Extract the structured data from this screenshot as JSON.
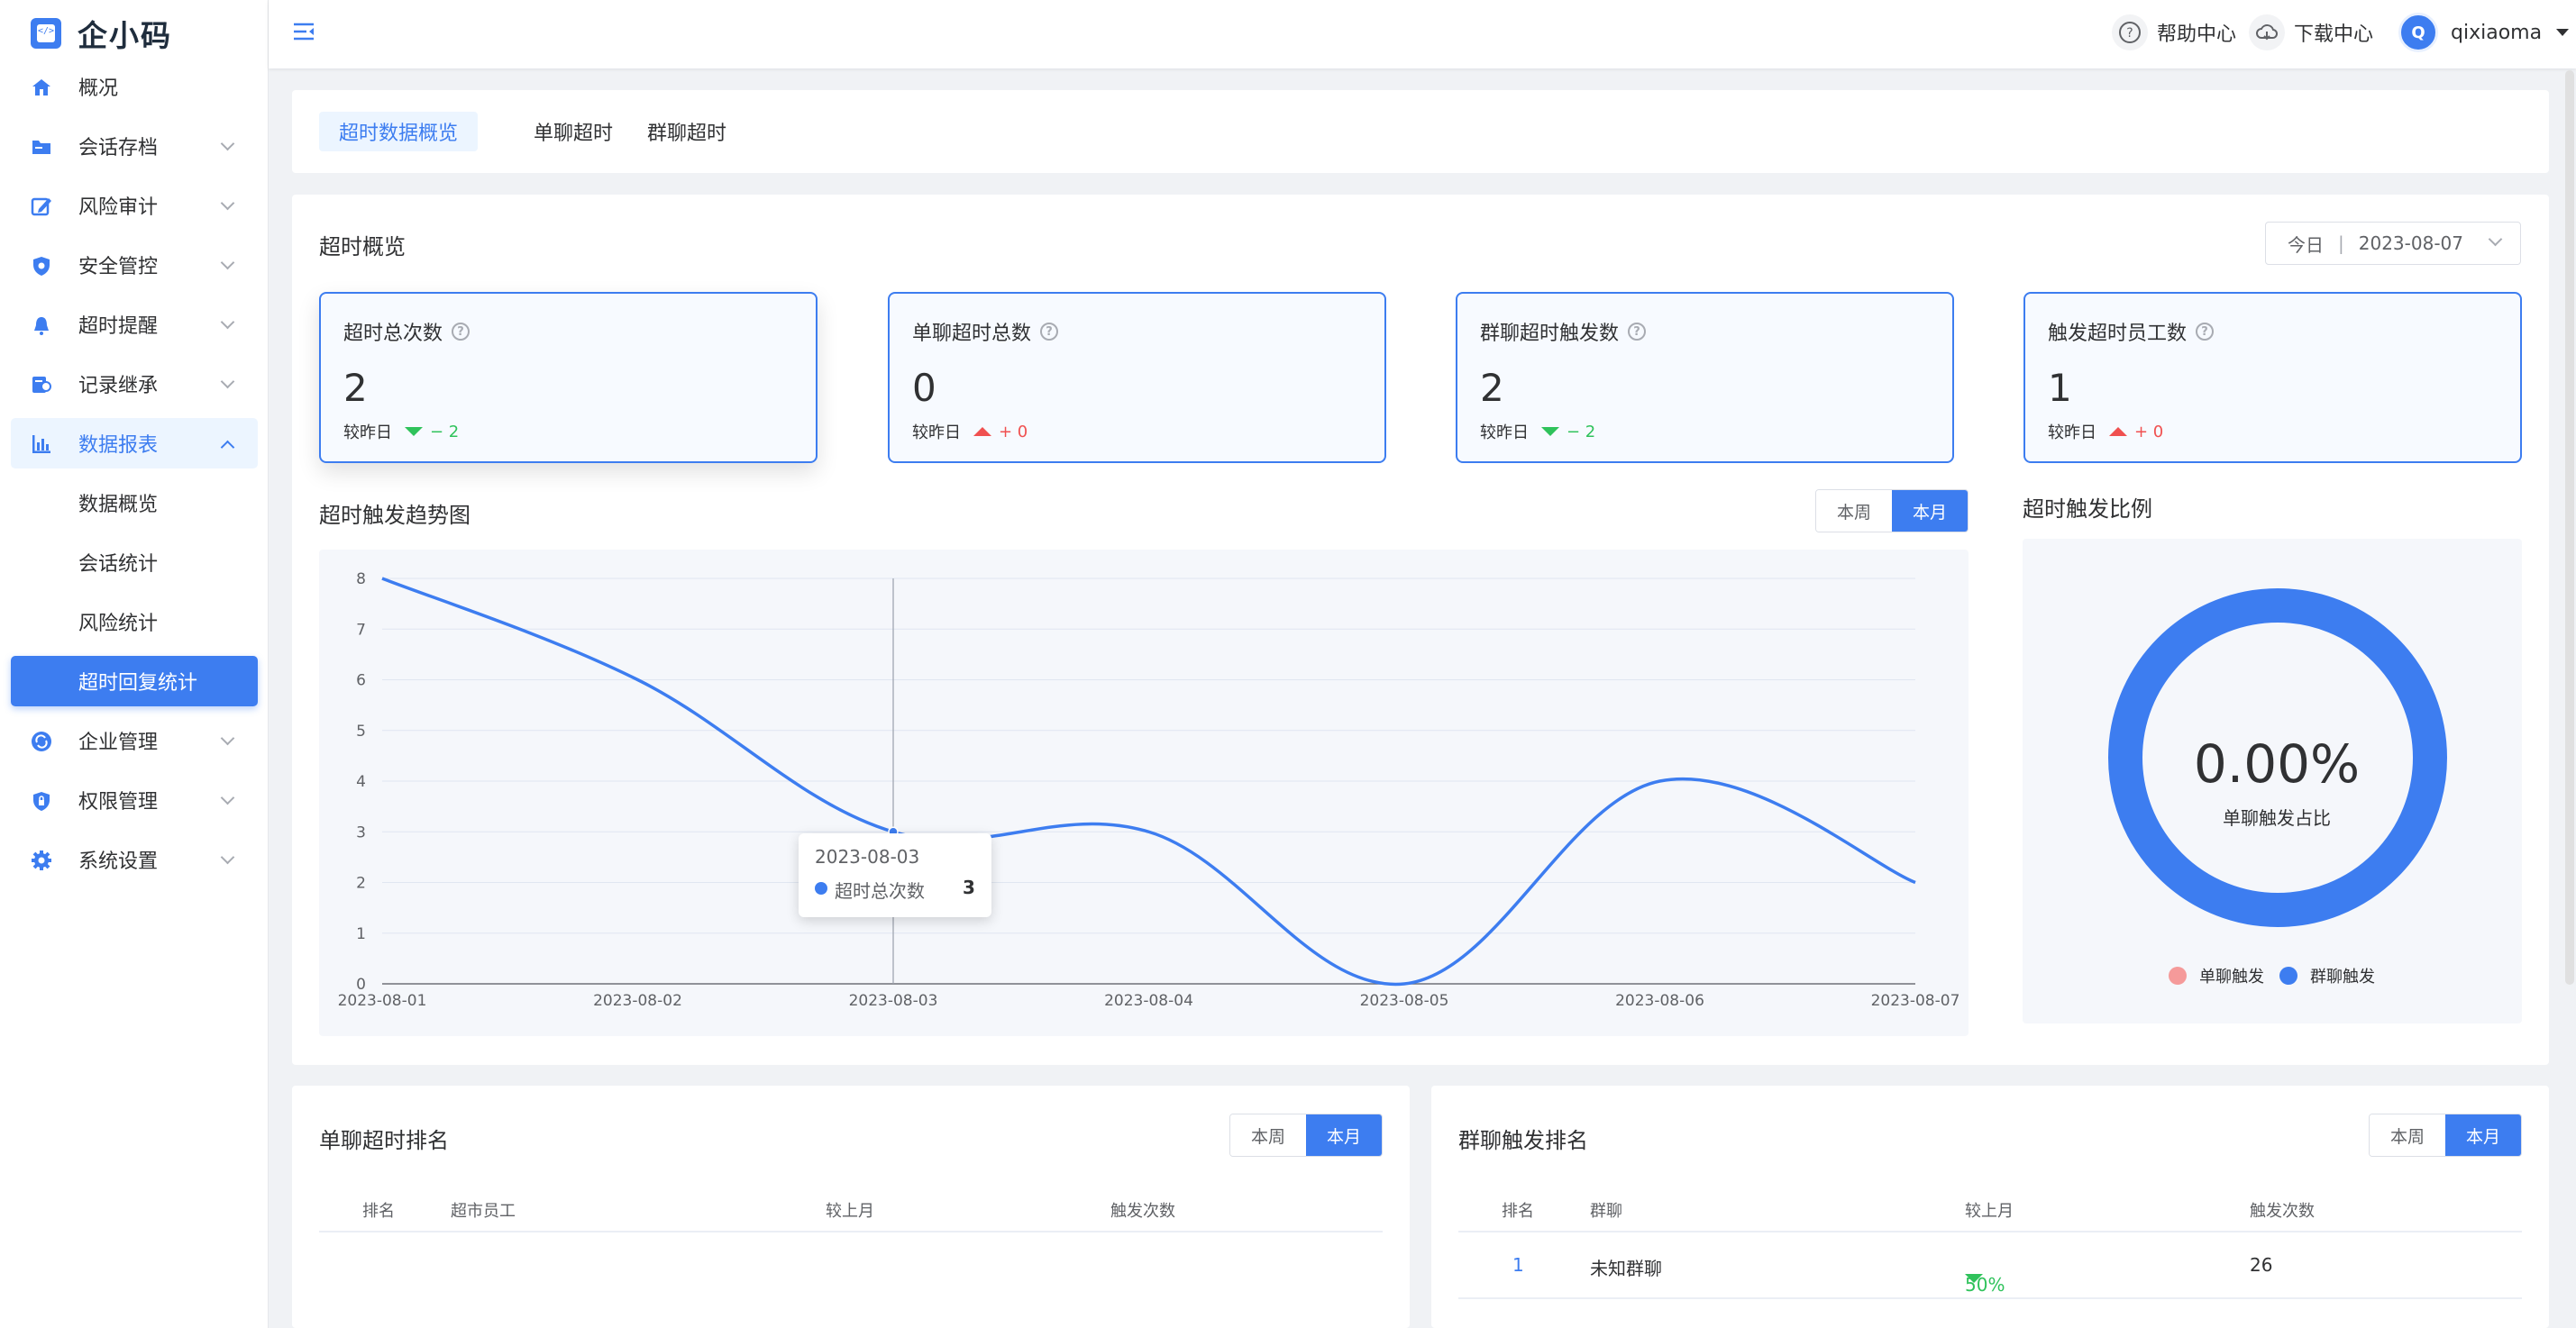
{
  "app": {
    "name": "企小码"
  },
  "sidebar": {
    "items": [
      {
        "label": "概况",
        "icon": "home-icon"
      },
      {
        "label": "会话存档",
        "icon": "folder-icon"
      },
      {
        "label": "风险审计",
        "icon": "edit-icon"
      },
      {
        "label": "安全管控",
        "icon": "shield-icon"
      },
      {
        "label": "超时提醒",
        "icon": "bell-icon"
      },
      {
        "label": "记录继承",
        "icon": "user-record-icon"
      },
      {
        "label": "数据报表",
        "icon": "bar-chart-icon"
      }
    ],
    "sub_items": [
      "数据概览",
      "会话统计",
      "风险统计",
      "超时回复统计"
    ],
    "items_after": [
      {
        "label": "企业管理",
        "icon": "sync-icon"
      },
      {
        "label": "权限管理",
        "icon": "lock-shield-icon"
      },
      {
        "label": "系统设置",
        "icon": "gear-icon"
      }
    ]
  },
  "topbar": {
    "help": "帮助中心",
    "download": "下载中心",
    "user_initial": "Q",
    "user_name": "qixiaoma"
  },
  "tabs": [
    "超时数据概览",
    "单聊超时",
    "群聊超时"
  ],
  "overview": {
    "title": "超时概览",
    "date_label": "今日",
    "date_value": "2023-08-07",
    "kpis": [
      {
        "label": "超时总次数",
        "value": "2",
        "cmp_label": "较昨日",
        "delta": "− 2",
        "dir": "down"
      },
      {
        "label": "单聊超时总数",
        "value": "0",
        "cmp_label": "较昨日",
        "delta": "+ 0",
        "dir": "up"
      },
      {
        "label": "群聊超时触发数",
        "value": "2",
        "cmp_label": "较昨日",
        "delta": "− 2",
        "dir": "down"
      },
      {
        "label": "触发超时员工数",
        "value": "1",
        "cmp_label": "较昨日",
        "delta": "+ 0",
        "dir": "up"
      }
    ]
  },
  "trend": {
    "title": "超时触发趋势图",
    "week": "本周",
    "month": "本月"
  },
  "chart_data": {
    "type": "line",
    "x": [
      "2023-08-01",
      "2023-08-02",
      "2023-08-03",
      "2023-08-04",
      "2023-08-05",
      "2023-08-06",
      "2023-08-07"
    ],
    "series": [
      {
        "name": "超时总次数",
        "values": [
          8,
          6,
          3,
          3,
          0,
          4,
          2
        ]
      }
    ],
    "ylim": [
      0,
      8
    ],
    "yticks": [
      0,
      1,
      2,
      3,
      4,
      5,
      6,
      7,
      8
    ],
    "color": "#3d7df0",
    "tooltip": {
      "date": "2023-08-03",
      "name": "超时总次数",
      "value": "3"
    }
  },
  "ratio": {
    "title": "超时触发比例",
    "percent": "0.00%",
    "subtitle": "单聊触发占比",
    "legend": [
      {
        "label": "单聊触发",
        "color": "#f59a9a"
      },
      {
        "label": "群聊触发",
        "color": "#3d7df0"
      }
    ]
  },
  "single_rank": {
    "title": "单聊超时排名",
    "week": "本周",
    "month": "本月",
    "headers": [
      "排名",
      "超市员工",
      "较上月",
      "触发次数"
    ]
  },
  "group_rank": {
    "title": "群聊触发排名",
    "week": "本周",
    "month": "本月",
    "headers": [
      "排名",
      "群聊",
      "较上月",
      "触发次数"
    ],
    "rows": [
      {
        "rank": "1",
        "name": "未知群聊",
        "change": "50%",
        "count": "26"
      }
    ]
  }
}
